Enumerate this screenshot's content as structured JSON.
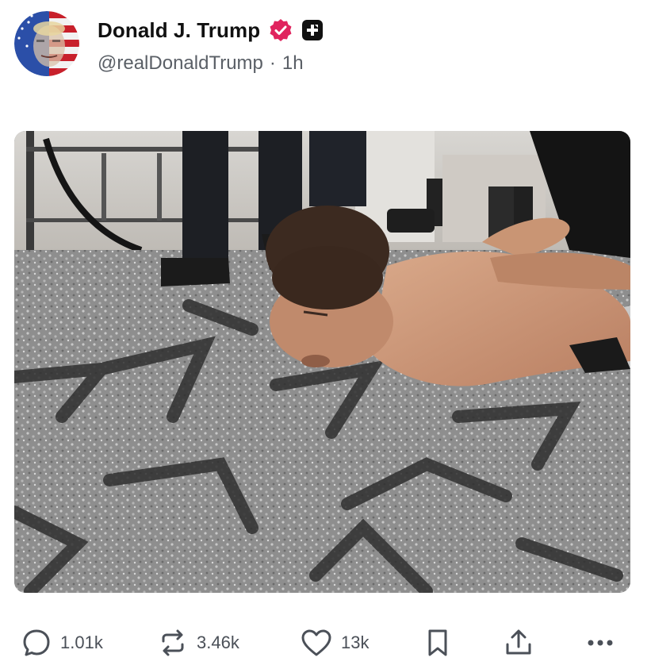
{
  "post": {
    "author": {
      "display_name": "Donald J. Trump",
      "handle": "@realDonaldTrump",
      "separator": "·",
      "time_ago": "1h",
      "verified": true,
      "avatar_icon": "avatar-flag-portrait",
      "badge_icon": "plus-badge-icon"
    },
    "media": {
      "type": "photo"
    },
    "actions": {
      "replies": "1.01k",
      "reposts": "3.46k",
      "likes": "13k"
    }
  },
  "colors": {
    "verified_badge": "#e0245e",
    "text_primary": "#111111",
    "text_secondary": "#5a5f66",
    "action_gray": "#4b5058"
  }
}
